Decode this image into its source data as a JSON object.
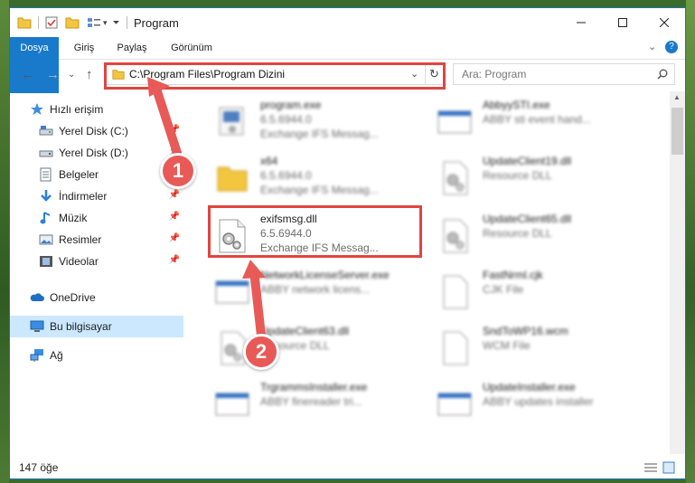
{
  "window": {
    "title": "Program"
  },
  "ribbon": {
    "tabs": [
      "Dosya",
      "Giriş",
      "Paylaş",
      "Görünüm"
    ]
  },
  "address": {
    "path": "C:\\Program Files\\Program Dizini"
  },
  "search": {
    "placeholder": "Ara: Program"
  },
  "sidebar": {
    "items": [
      {
        "label": "Hızlı erişim",
        "icon": "star-icon",
        "pinned": false
      },
      {
        "label": "Yerel Disk (C:)",
        "icon": "drive-icon",
        "pinned": true
      },
      {
        "label": "Yerel Disk (D:)",
        "icon": "drive-icon",
        "pinned": true
      },
      {
        "label": "Belgeler",
        "icon": "documents-icon",
        "pinned": true
      },
      {
        "label": "İndirmeler",
        "icon": "download-icon",
        "pinned": true
      },
      {
        "label": "Müzik",
        "icon": "music-icon",
        "pinned": true
      },
      {
        "label": "Resimler",
        "icon": "pictures-icon",
        "pinned": true
      },
      {
        "label": "Videolar",
        "icon": "video-icon",
        "pinned": true
      },
      {
        "label": "OneDrive",
        "icon": "cloud-icon",
        "pinned": false
      },
      {
        "label": "Bu bilgisayar",
        "icon": "computer-icon",
        "pinned": false,
        "selected": true
      },
      {
        "label": "Ağ",
        "icon": "network-icon",
        "pinned": false
      }
    ]
  },
  "files": [
    {
      "name": "program.exe",
      "version": "6.5.6944.0",
      "desc": "Exchange IFS Messag...",
      "type": "exe",
      "blurred": true
    },
    {
      "name": "AbbyySTI.exe",
      "version": "ABBY sti event hand...",
      "desc": "",
      "type": "window",
      "blurred": true
    },
    {
      "name": "x64",
      "version": "6.5.6944.0",
      "desc": "Exchange IFS Messag...",
      "type": "folder",
      "blurred": true
    },
    {
      "name": "UpdateClient19.dll",
      "version": "Resource DLL",
      "desc": "",
      "type": "dll",
      "blurred": true
    },
    {
      "name": "exifsmsg.dll",
      "version": "6.5.6944.0",
      "desc": "Exchange IFS Messag...",
      "type": "dll",
      "blurred": false
    },
    {
      "name": "UpdateClient65.dll",
      "version": "Resource DLL",
      "desc": "",
      "type": "dll",
      "blurred": true
    },
    {
      "name": "NetworkLicenseServer.exe",
      "version": "ABBY network licens...",
      "desc": "",
      "type": "window",
      "blurred": true
    },
    {
      "name": "FastNrml.cjk",
      "version": "CJK File",
      "desc": "",
      "type": "blank",
      "blurred": true
    },
    {
      "name": "UpdateClient63.dll",
      "version": "Resource DLL",
      "desc": "",
      "type": "dll",
      "blurred": true
    },
    {
      "name": "SndToWP16.wcm",
      "version": "WCM File",
      "desc": "",
      "type": "blank",
      "blurred": true
    },
    {
      "name": "TrgrammsInstaller.exe",
      "version": "ABBY finereader tri...",
      "desc": "",
      "type": "window",
      "blurred": true
    },
    {
      "name": "UpdateInstaller.exe",
      "version": "ABBY updates installer",
      "desc": "",
      "type": "window",
      "blurred": true
    }
  ],
  "status": {
    "count": "147 öğe"
  },
  "callouts": [
    "1",
    "2"
  ],
  "colors": {
    "accent": "#1979ca",
    "highlight": "#e0453f",
    "selected": "#cce8ff"
  }
}
